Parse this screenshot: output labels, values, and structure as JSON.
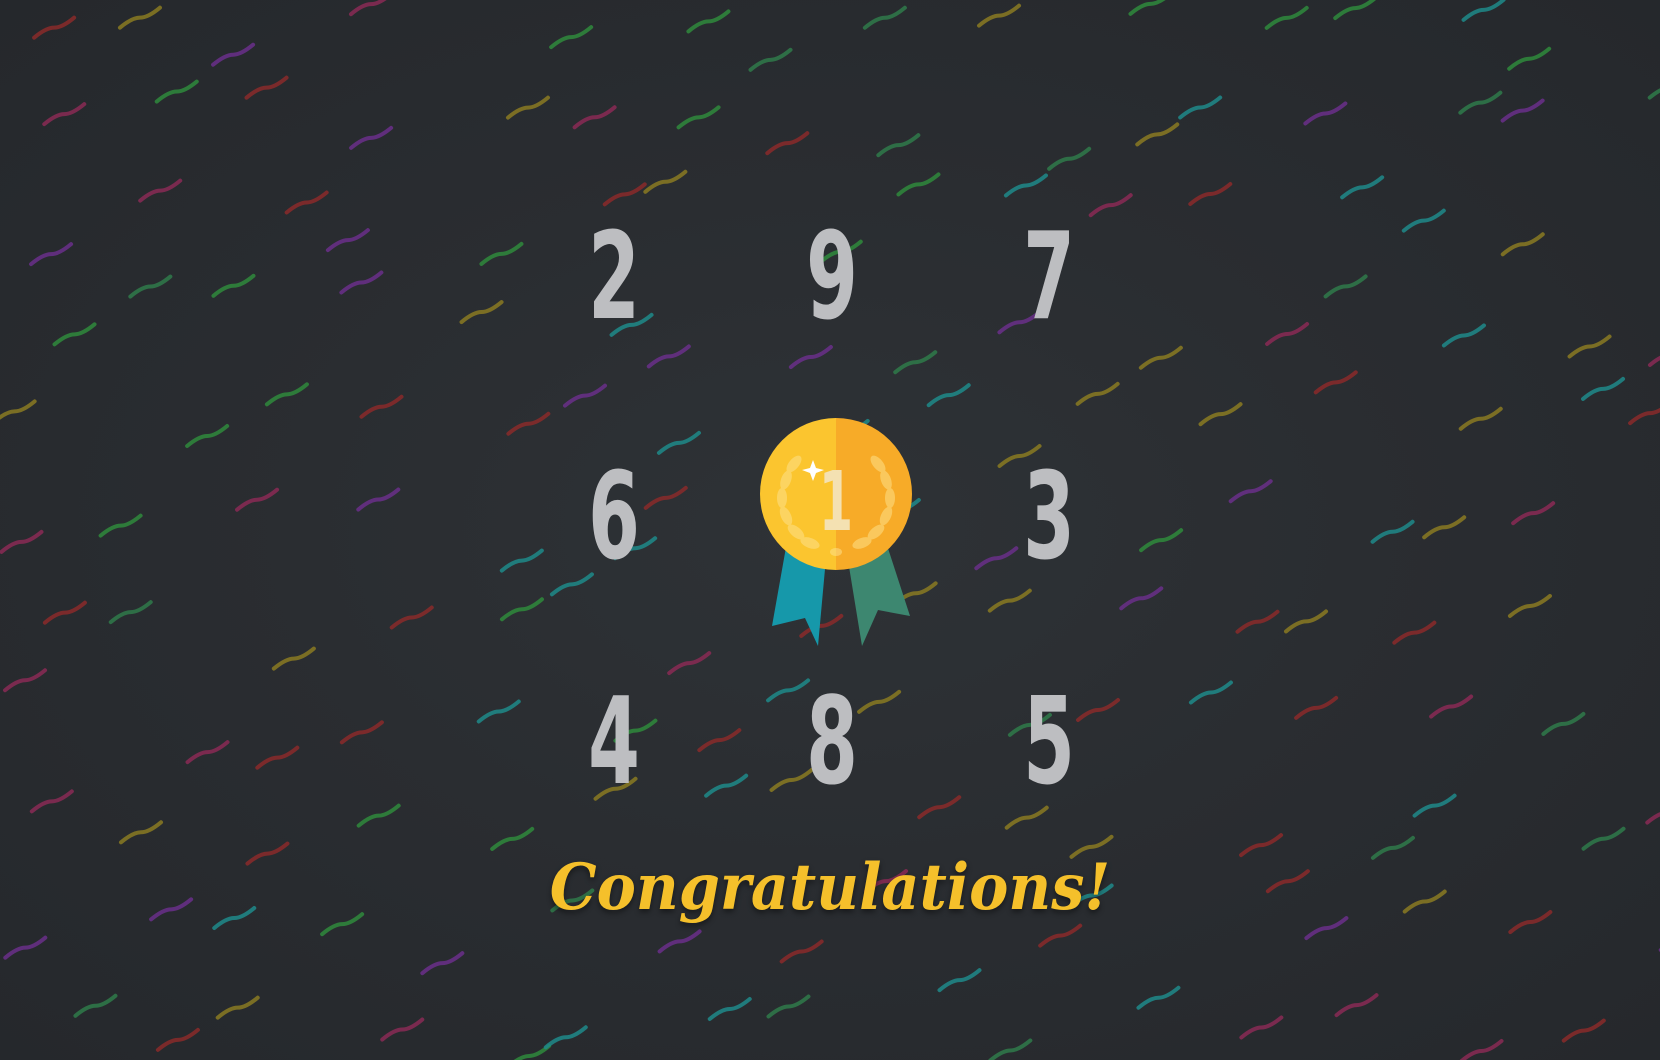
{
  "grid": {
    "top_row": [
      "2",
      "9",
      "7"
    ],
    "middle_row": [
      "6",
      "3"
    ],
    "bottom_row": [
      "4",
      "8",
      "5"
    ]
  },
  "medal": {
    "rank": "1",
    "colors": {
      "gold_left": "#fbc52f",
      "gold_right": "#f7ab28",
      "ribbon_left": "#1698aa",
      "ribbon_right": "#3d8770"
    }
  },
  "message": "Congratulations!",
  "colors": {
    "background": "#2a2d31",
    "digit": "#bdbec1",
    "message": "#f5c02b",
    "confetti": [
      "#8a2a2a",
      "#2f8a3c",
      "#1e8a8a",
      "#8a7a22",
      "#6a2f8a",
      "#8a2a55",
      "#2f7a4a"
    ]
  }
}
